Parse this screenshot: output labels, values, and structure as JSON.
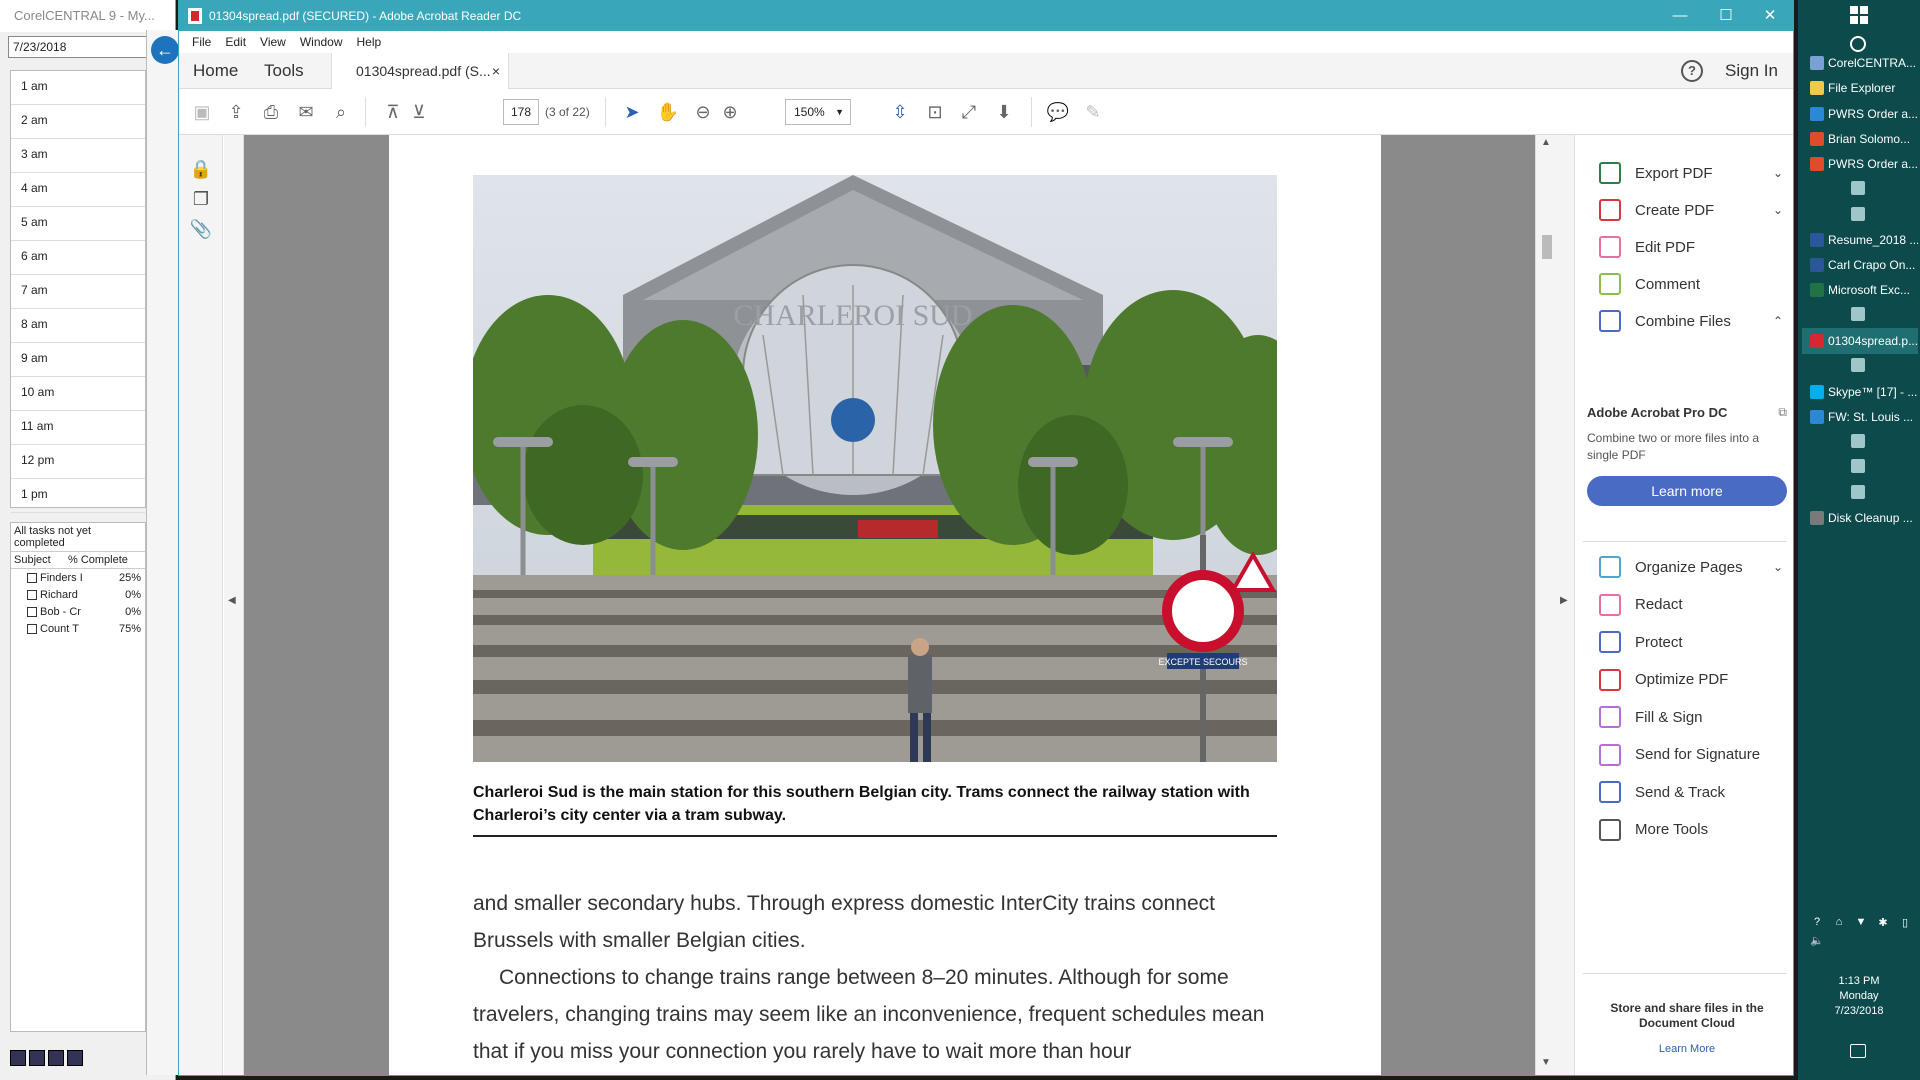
{
  "corel": {
    "title": "CorelCENTRAL 9 - My...",
    "date": "7/23/2018",
    "hours": [
      "1 am",
      "2 am",
      "3 am",
      "4 am",
      "5 am",
      "6 am",
      "7 am",
      "8 am",
      "9 am",
      "10 am",
      "11 am",
      "12 pm",
      "1 pm"
    ],
    "tasks_header": "All tasks not yet completed",
    "col_subject": "Subject",
    "col_complete": "% Complete",
    "tasks": [
      {
        "subject": "Finders I",
        "pct": "25%"
      },
      {
        "subject": "Richard",
        "pct": "0%"
      },
      {
        "subject": "Bob - Cr",
        "pct": "0%"
      },
      {
        "subject": "Count T",
        "pct": "75%"
      }
    ]
  },
  "window": {
    "title": "01304spread.pdf (SECURED) - Adobe Acrobat Reader DC",
    "minimize": "—",
    "maximize": "☐",
    "close": "✕"
  },
  "menu": [
    "File",
    "Edit",
    "View",
    "Window",
    "Help"
  ],
  "tabs": {
    "home": "Home",
    "tools": "Tools",
    "doc": "01304spread.pdf (S...",
    "doc_close": "×",
    "help": "?",
    "signin": "Sign In"
  },
  "toolbar": {
    "page_number": "178",
    "page_of": "(3 of 22)",
    "zoom": "150%"
  },
  "document": {
    "caption": "Charleroi Sud is the main station for this southern Belgian city. Trams connect the railway station with Charleroi’s city center via a tram subway.",
    "sign_text": "EXCEPTE SECOURS",
    "station_sign": "CHARLEROI SUD",
    "paragraph1": "and smaller secondary hubs. Through express domestic InterCity trains connect Brussels with smaller Belgian cities.",
    "paragraph2": "Connections to change trains range between 8–20 minutes. Although for some travelers, changing trains may seem like an inconvenience, frequent schedules mean that if you miss your connection you rarely have to wait more than hour"
  },
  "tools_panel": {
    "items": [
      {
        "label": "Export PDF",
        "chevron": "⌄",
        "color": "#2d7d46"
      },
      {
        "label": "Create PDF",
        "chevron": "⌄",
        "color": "#d7373f"
      },
      {
        "label": "Edit PDF",
        "chevron": "",
        "color": "#e86ea3"
      },
      {
        "label": "Comment",
        "chevron": "",
        "color": "#8cbf4a"
      },
      {
        "label": "Combine Files",
        "chevron": "⌃",
        "color": "#4a6bc4"
      }
    ],
    "promo_title": "Adobe Acrobat Pro DC",
    "promo_text": "Combine two or more files into a single PDF",
    "promo_button": "Learn more",
    "items2": [
      {
        "label": "Organize Pages",
        "chevron": "⌄",
        "color": "#4ca7c9"
      },
      {
        "label": "Redact",
        "chevron": "",
        "color": "#e86ea3"
      },
      {
        "label": "Protect",
        "chevron": "",
        "color": "#4a6bc4"
      },
      {
        "label": "Optimize PDF",
        "chevron": "",
        "color": "#d7373f"
      },
      {
        "label": "Fill & Sign",
        "chevron": "",
        "color": "#b46ed6"
      },
      {
        "label": "Send for Signature",
        "chevron": "",
        "color": "#b46ed6"
      },
      {
        "label": "Send & Track",
        "chevron": "",
        "color": "#4a6bc4"
      },
      {
        "label": "More Tools",
        "chevron": "",
        "color": "#555555"
      }
    ],
    "store_text": "Store and share files in the Document Cloud",
    "store_link": "Learn More"
  },
  "taskbar": {
    "items": [
      {
        "label": "CorelCENTRA...",
        "color": "#7aa0d4"
      },
      {
        "label": "File Explorer",
        "color": "#f2c94c"
      },
      {
        "label": "PWRS Order a...",
        "color": "#2b88d8"
      },
      {
        "label": "Brian Solomo...",
        "color": "#e04b2d"
      },
      {
        "label": "PWRS Order a...",
        "color": "#e04b2d"
      },
      {
        "label": "Resume_2018 ...",
        "color": "#2b579a"
      },
      {
        "label": "Carl Crapo On...",
        "color": "#2b579a"
      },
      {
        "label": "Microsoft Exc...",
        "color": "#217346"
      },
      {
        "label": "01304spread.p...",
        "color": "#d7272f"
      },
      {
        "label": "Skype™ [17] - ...",
        "color": "#00aff0"
      },
      {
        "label": "FW: St. Louis ...",
        "color": "#2b88d8"
      },
      {
        "label": "Disk Cleanup ...",
        "color": "#7a7a7a"
      }
    ],
    "time": "1:13 PM",
    "day": "Monday",
    "date": "7/23/2018"
  }
}
